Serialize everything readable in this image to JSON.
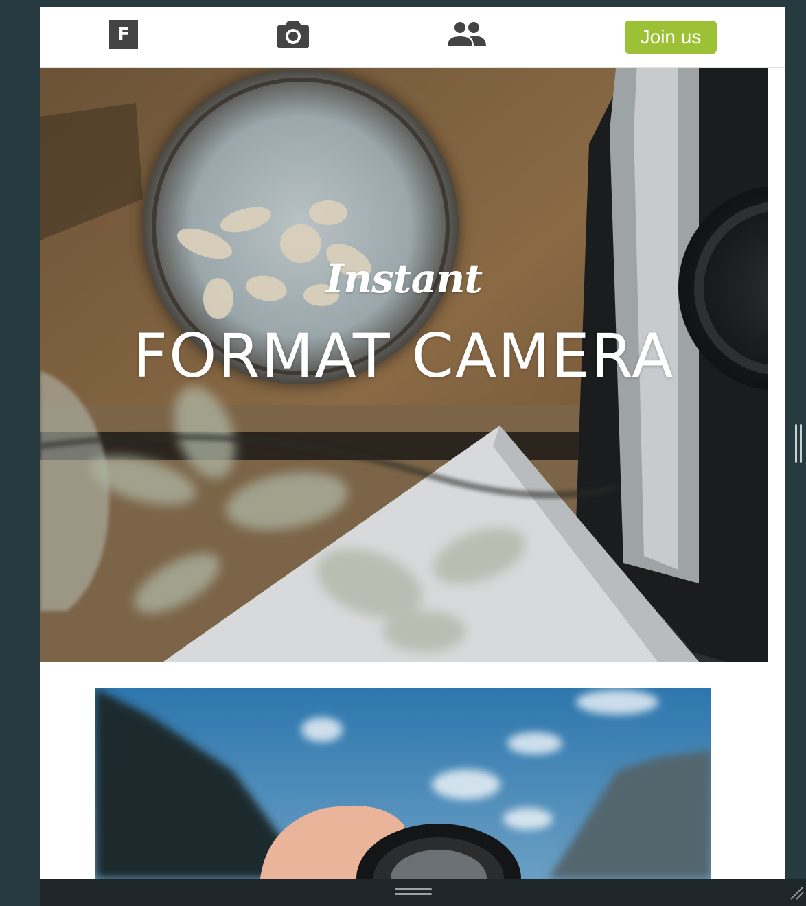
{
  "navbar": {
    "logo_letter": "F",
    "camera_icon": "camera-icon",
    "people_icon": "people-icon",
    "join_label": "Join us",
    "join_color": "#9dc136"
  },
  "hero": {
    "script_text": "Instant",
    "title": "FORMAT CAMERA",
    "image_subject": "overhead view of camera, ceramic bowl and blurred plant on wooden table"
  },
  "second_image": {
    "image_subject": "hand holding camera lens against blue sky and mountains"
  },
  "colors": {
    "page_bg": "#263a40",
    "bottom_bar": "#1f2629",
    "accent": "#9dc136"
  }
}
